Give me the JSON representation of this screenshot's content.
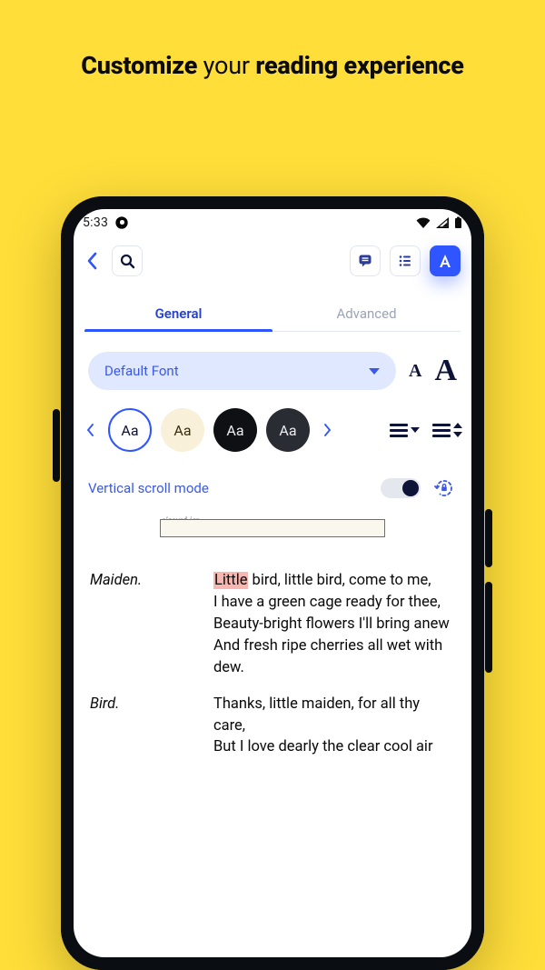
{
  "headline": {
    "w1": "Customize",
    "w2": "your",
    "w3": "reading experience"
  },
  "statusbar": {
    "time": "5:33"
  },
  "tabs": {
    "general": "General",
    "advanced": "Advanced"
  },
  "font": {
    "select_label": "Default Font",
    "size_small": "A",
    "size_big": "A"
  },
  "swatch_label": "Aa",
  "scroll": {
    "label": "Vertical scroll mode"
  },
  "poem": {
    "s1": {
      "speaker": "Maiden.",
      "l1": {
        "hl": "Little",
        "rest": " bird, little bird, come to me,"
      },
      "l2": "I have a green cage ready for thee,",
      "l3": "Beauty-bright flowers I'll bring anew",
      "l4": "And fresh ripe cherries all wet with dew."
    },
    "s2": {
      "speaker": "Bird.",
      "l1": "Thanks, little maiden, for all thy care,",
      "l2": "But I love dearly the clear cool air"
    }
  }
}
